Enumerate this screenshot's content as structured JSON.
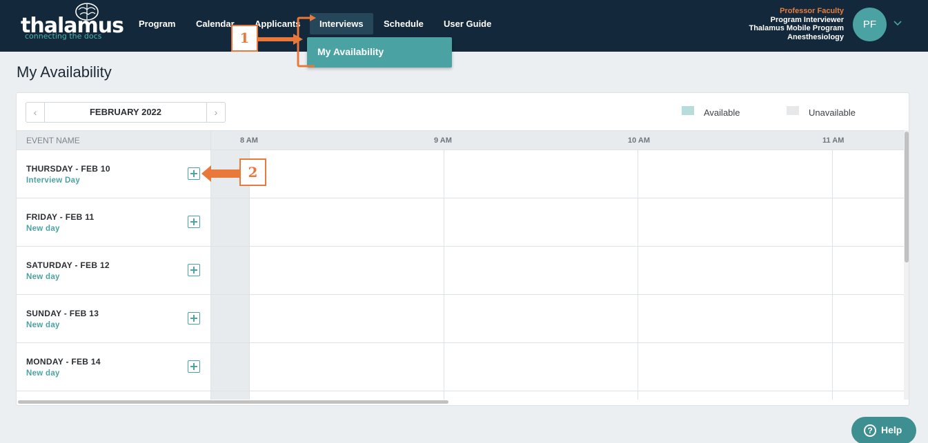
{
  "brand": {
    "name": "thalamus",
    "tagline": "connecting the docs"
  },
  "nav": {
    "items": [
      {
        "label": "Program"
      },
      {
        "label": "Calendar"
      },
      {
        "label": "Applicants"
      },
      {
        "label": "Interviews"
      },
      {
        "label": "Schedule"
      },
      {
        "label": "User Guide"
      }
    ],
    "active": "Interviews",
    "dropdown": {
      "item": "My Availability"
    }
  },
  "user": {
    "name": "Professor Faculty",
    "role": "Program Interviewer",
    "program": "Thalamus Mobile Program",
    "department": "Anesthesiology",
    "initials": "PF"
  },
  "page": {
    "title": "My Availability"
  },
  "calendar": {
    "month": "FEBRUARY 2022",
    "prev_icon": "chevron-left-icon",
    "next_icon": "chevron-right-icon"
  },
  "legend": {
    "available_label": "Available",
    "unavailable_label": "Unavailable",
    "available_color": "#b7dcdb",
    "unavailable_color": "#e6e8ea"
  },
  "grid": {
    "event_column_header": "EVENT NAME",
    "time_headers": [
      "8 AM",
      "9 AM",
      "10 AM",
      "11 AM"
    ],
    "rows": [
      {
        "day": "THURSDAY - FEB 10",
        "event": "Interview Day"
      },
      {
        "day": "FRIDAY - FEB 11",
        "event": "New day"
      },
      {
        "day": "SATURDAY - FEB 12",
        "event": "New day"
      },
      {
        "day": "SUNDAY - FEB 13",
        "event": "New day"
      },
      {
        "day": "MONDAY - FEB 14",
        "event": "New day"
      }
    ]
  },
  "annotations": {
    "step1": "1",
    "step2": "2",
    "color": "#e8793b"
  },
  "help": {
    "label": "Help",
    "icon": "question-circle-icon"
  },
  "colors": {
    "topbar": "#13283b",
    "accent": "#4aa3a2",
    "user_name": "#e87e3c"
  }
}
